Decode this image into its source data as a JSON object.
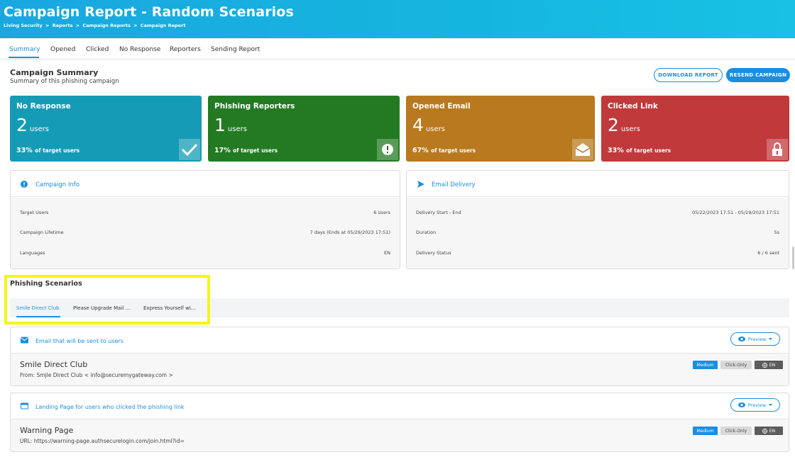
{
  "header": {
    "title": "Campaign Report - Random Scenarios",
    "breadcrumb": [
      "Living Security",
      ">",
      "Reports",
      ">",
      "Campaign Reports",
      ">",
      "Campaign Report"
    ]
  },
  "tabs": [
    "Summary",
    "Opened",
    "Clicked",
    "No Response",
    "Reporters",
    "Sending Report"
  ],
  "summary": {
    "title": "Campaign Summary",
    "subtitle": "Summary of this phishing campaign",
    "download_label": "DOWNLOAD REPORT",
    "resend_label": "RESEND CAMPAIGN"
  },
  "cards": [
    {
      "title": "No Response",
      "value": "2",
      "unit": "users",
      "pct": "33%",
      "pct_label": "of target users",
      "color": "#159bb5",
      "icon": "check-icon"
    },
    {
      "title": "Phishing Reporters",
      "value": "1",
      "unit": "users",
      "pct": "17%",
      "pct_label": "of target users",
      "color": "#237a22",
      "icon": "alert-circle-icon"
    },
    {
      "title": "Opened Email",
      "value": "4",
      "unit": "users",
      "pct": "67%",
      "pct_label": "of target users",
      "color": "#b8791f",
      "icon": "open-envelope-icon"
    },
    {
      "title": "Clicked Link",
      "value": "2",
      "unit": "users",
      "pct": "33%",
      "pct_label": "of target users",
      "color": "#c0393b",
      "icon": "lock-icon"
    }
  ],
  "campaign_info": {
    "title": "Campaign Info",
    "rows": [
      {
        "label": "Target Users",
        "value": "6 users"
      },
      {
        "label": "Campaign Lifetime",
        "value": "7 days (Ends at 05/29/2023 17:51)"
      },
      {
        "label": "Languages",
        "value": "EN"
      }
    ]
  },
  "email_delivery": {
    "title": "Email Delivery",
    "rows": [
      {
        "label": "Delivery Start - End",
        "value": "05/22/2023 17:51 - 05/29/2023 17:51"
      },
      {
        "label": "Duration",
        "value": "5s"
      },
      {
        "label": "Delivery Status",
        "value": "6 / 6 sent"
      }
    ]
  },
  "phishing_scenarios": {
    "title": "Phishing Scenarios",
    "tabs": [
      "Smile Direct Club",
      "Please Upgrade Mail ...",
      "Express Yourself wi..."
    ]
  },
  "email_block": {
    "title": "Email that will be sent to users",
    "preview_label": "Preview",
    "name": "Smile Direct Club",
    "meta": "From: Smjle Direct Club < info@securemygateway.com >",
    "badges": {
      "difficulty": "Medium",
      "type": "Click-Only",
      "lang": "EN"
    }
  },
  "landing_block": {
    "title": "Landing Page for users who clicked the phishing link",
    "preview_label": "Preview",
    "name": "Warning Page",
    "meta": "URL: https://warning-page.authsecurelogin.com/join.html?id=",
    "badges": {
      "difficulty": "Medium",
      "type": "Click-Only",
      "lang": "EN"
    }
  },
  "colors": {
    "accent": "#1a8ee0",
    "highlight": "#f5f51a"
  }
}
